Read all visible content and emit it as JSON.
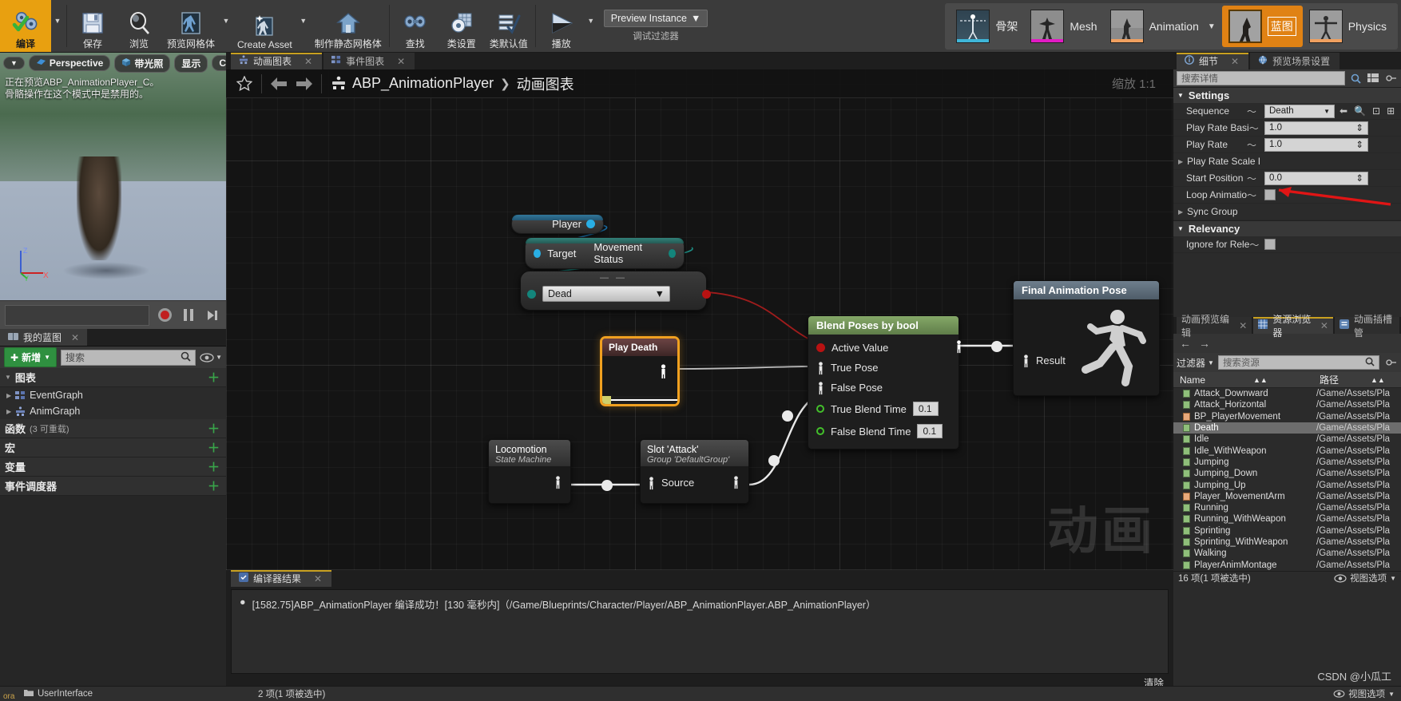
{
  "toolbar": {
    "compile": {
      "label": "编译",
      "icon": "gears-check-icon"
    },
    "items": [
      {
        "label": "保存",
        "icon": "save-icon",
        "dropdown": false
      },
      {
        "label": "浏览",
        "icon": "browse-icon",
        "dropdown": false
      },
      {
        "label": "预览网格体",
        "icon": "preview-mesh-icon",
        "dropdown": true
      },
      {
        "label": "Create Asset",
        "icon": "create-asset-icon",
        "dropdown": true
      },
      {
        "label": "制作静态网格体",
        "icon": "make-static-mesh-icon",
        "dropdown": false
      },
      {
        "label": "查找",
        "icon": "find-icon",
        "dropdown": false
      },
      {
        "label": "类设置",
        "icon": "class-settings-icon",
        "dropdown": false
      },
      {
        "label": "类默认值",
        "icon": "class-defaults-icon",
        "dropdown": false
      },
      {
        "label": "播放",
        "icon": "play-icon",
        "dropdown": true
      }
    ],
    "preview_instance": {
      "value": "Preview Instance",
      "caption": "调试过滤器"
    },
    "modes": [
      {
        "label": "骨架",
        "active": false,
        "underline": "#3fb6d8"
      },
      {
        "label": "Mesh",
        "active": false,
        "underline": "#e21ac4"
      },
      {
        "label": "Animation",
        "active": false,
        "underline": "#f0a060",
        "dropdown": true
      },
      {
        "label": "蓝图",
        "active": true,
        "underline": "#f0a060"
      },
      {
        "label": "Physics",
        "active": false,
        "underline": "#f0a060"
      }
    ]
  },
  "viewport": {
    "buttons": [
      {
        "label": "",
        "icon": "chevron-down-icon"
      },
      {
        "label": "Perspective",
        "icon": "perspective-icon"
      },
      {
        "label": "带光照",
        "icon": "lit-cube-icon"
      },
      {
        "label": "显示",
        "icon": ""
      },
      {
        "label": "Character",
        "icon": ""
      }
    ],
    "note_line1": "正在预览ABP_AnimationPlayer_C。",
    "note_line2": "骨骼操作在这个模式中是禁用的。",
    "axis": {
      "x": "X",
      "y": "Y",
      "z": "Z"
    },
    "transport": {
      "record": "record-button",
      "pause": "pause-button",
      "step": "step-button"
    }
  },
  "my_blueprint": {
    "tab_label": "我的蓝图",
    "add_button": "新增",
    "search_placeholder": "搜索",
    "sections": [
      {
        "label": "图表",
        "sub": "",
        "expanded": true,
        "items": [
          {
            "label": "EventGraph",
            "icon": "event-graph-icon"
          },
          {
            "label": "AnimGraph",
            "icon": "anim-graph-icon"
          }
        ]
      },
      {
        "label": "函数",
        "sub": "(3 可重载)",
        "expanded": false,
        "items": []
      },
      {
        "label": "宏",
        "sub": "",
        "expanded": false,
        "items": []
      },
      {
        "label": "变量",
        "sub": "",
        "expanded": false,
        "items": []
      },
      {
        "label": "事件调度器",
        "sub": "",
        "expanded": false,
        "items": []
      }
    ]
  },
  "graph": {
    "tabs": [
      {
        "label": "动画图表",
        "icon": "anim-graph-icon",
        "selected": true
      },
      {
        "label": "事件图表",
        "icon": "event-graph-icon",
        "selected": false
      }
    ],
    "breadcrumb": {
      "root": "ABP_AnimationPlayer",
      "separator": "❯",
      "leaf": "动画图表"
    },
    "zoom_label": "缩放 1:1",
    "watermark": "动画",
    "nodes": {
      "player": {
        "title": "Player",
        "pin": "blue-output-pin"
      },
      "movement_status": {
        "input": "Target",
        "output": "Movement Status"
      },
      "equals_node": {
        "value": "Dead",
        "title_dashes": "— —"
      },
      "play_death": {
        "title": "Play Death"
      },
      "blend_poses": {
        "title": "Blend Poses by bool",
        "rows": [
          {
            "label": "Active Value",
            "pin": "red",
            "value": ""
          },
          {
            "label": "True Pose",
            "pin": "pose",
            "value": ""
          },
          {
            "label": "False Pose",
            "pin": "pose",
            "value": ""
          },
          {
            "label": "True Blend Time",
            "pin": "green",
            "value": "0.1"
          },
          {
            "label": "False Blend Time",
            "pin": "green",
            "value": "0.1"
          }
        ]
      },
      "final_pose": {
        "title": "Final Animation Pose",
        "result": "Result"
      },
      "locomotion": {
        "title": "Locomotion",
        "subtitle": "State Machine"
      },
      "slot_attack": {
        "title": "Slot 'Attack'",
        "subtitle": "Group 'DefaultGroup'",
        "source": "Source"
      }
    }
  },
  "compiler_results": {
    "tab_label": "编译器结果",
    "message": "[1582.75]ABP_AnimationPlayer 编译成功！[130 毫秒内]（/Game/Blueprints/Character/Player/ABP_AnimationPlayer.ABP_AnimationPlayer）",
    "clear_label": "清除"
  },
  "details": {
    "tabs": [
      {
        "label": "细节",
        "icon": "info-icon",
        "selected": true
      },
      {
        "label": "预览场景设置",
        "icon": "scene-icon",
        "selected": false
      }
    ],
    "search_placeholder": "搜索详情",
    "categories": [
      {
        "name": "Settings",
        "properties": [
          {
            "label": "Sequence",
            "type": "combo",
            "value": "Death",
            "has_reset": true,
            "extras": [
              "back-arrow-icon",
              "browse-icon",
              "use-selected-icon",
              "new-icon"
            ]
          },
          {
            "label": "Play Rate Basi",
            "type": "number",
            "value": "1.0",
            "has_reset": true
          },
          {
            "label": "Play Rate",
            "type": "number",
            "value": "1.0",
            "has_reset": true
          },
          {
            "label": "Play Rate Scale Bi",
            "type": "expandable",
            "value": "",
            "has_reset": false
          },
          {
            "label": "Start Position",
            "type": "number",
            "value": "0.0",
            "has_reset": true
          },
          {
            "label": "Loop Animatio",
            "type": "checkbox",
            "value": "unchecked",
            "has_reset": true
          },
          {
            "label": "Sync Group",
            "type": "expandable",
            "value": "",
            "has_reset": false
          }
        ]
      },
      {
        "name": "Relevancy",
        "properties": [
          {
            "label": "Ignore for Rele",
            "type": "checkbox",
            "value": "unchecked",
            "has_reset": true
          }
        ]
      }
    ]
  },
  "asset_browser": {
    "tabs": [
      {
        "label": "动画预览编辑",
        "icon": "anim-preview-icon",
        "selected": false
      },
      {
        "label": "资源浏览器",
        "icon": "asset-browser-icon",
        "selected": true
      },
      {
        "label": "动画插槽管",
        "icon": "anim-slot-icon",
        "selected": false
      }
    ],
    "nav": {
      "back": "back-arrow-icon",
      "forward": "forward-arrow-icon"
    },
    "filter_label": "过滤器",
    "search_placeholder": "搜索资源",
    "columns": [
      "Name",
      "路径"
    ],
    "rows": [
      {
        "name": "Attack_Downward",
        "path": "/Game/Assets/Pla",
        "type": "anim",
        "selected": false
      },
      {
        "name": "Attack_Horizontal",
        "path": "/Game/Assets/Pla",
        "type": "anim",
        "selected": false
      },
      {
        "name": "BP_PlayerMovement",
        "path": "/Game/Assets/Pla",
        "type": "blueprint",
        "selected": false
      },
      {
        "name": "Death",
        "path": "/Game/Assets/Pla",
        "type": "anim",
        "selected": true
      },
      {
        "name": "Idle",
        "path": "/Game/Assets/Pla",
        "type": "anim",
        "selected": false
      },
      {
        "name": "Idle_WithWeapon",
        "path": "/Game/Assets/Pla",
        "type": "anim",
        "selected": false
      },
      {
        "name": "Jumping",
        "path": "/Game/Assets/Pla",
        "type": "anim",
        "selected": false
      },
      {
        "name": "Jumping_Down",
        "path": "/Game/Assets/Pla",
        "type": "anim",
        "selected": false
      },
      {
        "name": "Jumping_Up",
        "path": "/Game/Assets/Pla",
        "type": "anim",
        "selected": false
      },
      {
        "name": "Player_MovementArm",
        "path": "/Game/Assets/Pla",
        "type": "blueprint",
        "selected": false
      },
      {
        "name": "Running",
        "path": "/Game/Assets/Pla",
        "type": "anim",
        "selected": false
      },
      {
        "name": "Running_WithWeapon",
        "path": "/Game/Assets/Pla",
        "type": "anim",
        "selected": false
      },
      {
        "name": "Sprinting",
        "path": "/Game/Assets/Pla",
        "type": "anim",
        "selected": false
      },
      {
        "name": "Sprinting_WithWeapon",
        "path": "/Game/Assets/Pla",
        "type": "anim",
        "selected": false
      },
      {
        "name": "Walking",
        "path": "/Game/Assets/Pla",
        "type": "anim",
        "selected": false
      },
      {
        "name": "PlayerAnimMontage",
        "path": "/Game/Assets/Pla",
        "type": "anim",
        "selected": false
      }
    ],
    "footer_count": "16 项(1 项被选中)",
    "footer_options": "视图选项"
  },
  "statusbar": {
    "left_label": "UserInterface",
    "mid_label": "2 项(1 项被选中)",
    "right_label": "视图选项",
    "corner_left": "ora"
  },
  "watermark_credit": "CSDN @小瓜工",
  "colors": {
    "accent_orange": "#e8a010",
    "mode_active": "#e08214",
    "green_add": "#2f9040",
    "pin_blue": "#29aee4",
    "pin_teal": "#13857b",
    "pin_red": "#b81212",
    "pin_green": "#43c02b",
    "node_blend_header": "#7a9c5e",
    "node_final_header": "#5f6f7c",
    "selection_orange": "#f0a020"
  }
}
